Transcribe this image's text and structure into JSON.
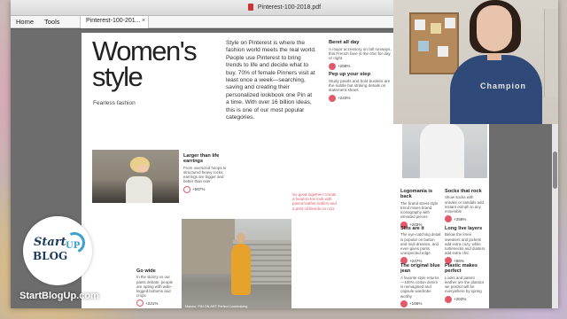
{
  "window": {
    "title": "Pinterest-100-2018.pdf"
  },
  "toolbar": {
    "home": "Home",
    "tools": "Tools",
    "tab_label": "Pinterest-100-201...",
    "tab_close": "×"
  },
  "page": {
    "headline": "Women's style",
    "subhead": "Fearless fashion",
    "intro": "Style on Pinterest is where the fashion world meets the real world. People use Pinterest to bring trends to life and decide what to buy. 70% of female Pinners visit at least once a week—searching, saving and creating their personalized lookbook one Pin at a time. With over 16 billion ideas, this is one of our most popular categories.",
    "side_stats": [
      {
        "title": "Beret all day",
        "desc": "A major accessory on fall runways, this French fave is the chic for day or night",
        "value": "+268%"
      },
      {
        "title": "Pep up your step",
        "desc": "Study pearls and bold buckles are the subtle but striking details on statement shoes",
        "value": "+223%"
      }
    ],
    "block_earrings": {
      "title": "Larger than life earrings",
      "desc": "From oversized hoops to structured heavy rocks, earrings are bigger and better than ever",
      "value": "+567%"
    },
    "block_pink": "So good together! Create a head-to-toe look with paired leather loafers and a print oil blends no ni11",
    "block_go_wide": {
      "title": "Go wide",
      "desc": "In the skinny vs out pants debate, people are opting with wide-legged bottoms and crops",
      "value": "+221%"
    },
    "photo_b_caption": "Maison, PIN ON ART Perfect Lookmaking",
    "right_blocks": [
      {
        "title": "Logomania is back",
        "desc": "The brand street style trend mixes brand iconography with elevated pieces",
        "value": "+203%"
      },
      {
        "title": "Socks that rock",
        "desc": "Show socks with sneaks or sandals add instant oomph to any ensemble",
        "value": "+259%"
      },
      {
        "title": "Slits are it",
        "desc": "The eye-catching detail is popular on button and midi dresses, and even gives pants unexpected edge",
        "value": "+247%"
      },
      {
        "title": "Long live layers",
        "desc": "Below the knee sweaters and jackets add extra cozy, while turtlenecks and dusters add extra chic",
        "value": "+86%"
      },
      {
        "title": "The original blue jean",
        "desc": "A favorite style returns—100% cotton denim is reimagined and capsule wardrobe worthy",
        "value": "+105%"
      },
      {
        "title": "Plastic makes perfect",
        "desc": "Looks and patent leather are the plastics we predict will be everywhere by spring",
        "value": "+203%"
      }
    ]
  },
  "webcam": {
    "shirt_text": "Champion"
  },
  "logo": {
    "line1": "Start",
    "line2": "BLOG",
    "line3": "UP"
  },
  "site_url": "StartBlogUp.com",
  "colors": {
    "accent": "#e25a6a",
    "logo_navy": "#1d3a5c",
    "logo_blue": "#3aa0cf"
  }
}
